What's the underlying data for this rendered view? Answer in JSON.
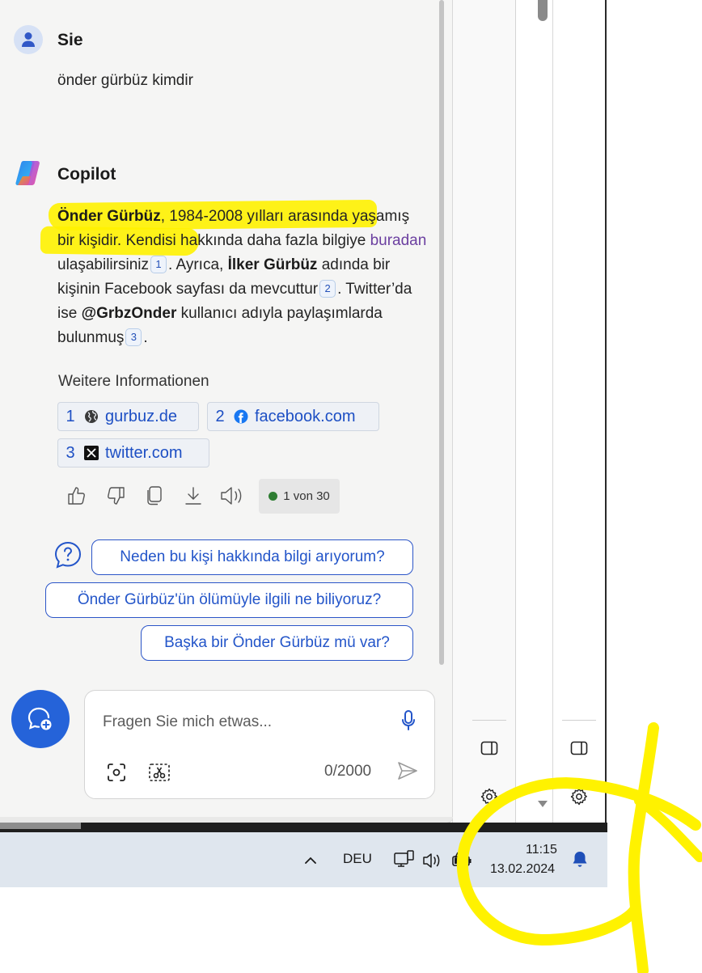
{
  "conversation": {
    "user": {
      "name": "Sie",
      "message": "önder gürbüz kimdir"
    },
    "assistant": {
      "name": "Copilot",
      "answer": {
        "p1_bold": "Önder Gürbüz",
        "p1_a": ", 1984-2008 yılları arasında yaşamış bir kişidir. Kendisi hakkında daha fazla bilgiye ",
        "link": "buradan",
        "p1_b": " ulaşabilirsiniz",
        "cite1": "1",
        "p2_a": ". Ayrıca, ",
        "p2_bold": "İlker Gürbüz",
        "p2_b": " adında bir kişinin Facebook sayfası da mevcuttur",
        "cite2": "2",
        "p3_a": ". Twitter’da ise ",
        "p3_bold": "@GrbzOnder",
        "p3_b": " kullanıcı adıyla paylaşımlarda bulunmuş",
        "cite3": "3",
        "end": "."
      },
      "more_info_title": "Weitere Informationen",
      "sources": [
        {
          "num": "1",
          "label": "gurbuz.de",
          "icon": "globe-icon"
        },
        {
          "num": "2",
          "label": "facebook.com",
          "icon": "facebook-icon"
        },
        {
          "num": "3",
          "label": "twitter.com",
          "icon": "x-icon"
        }
      ],
      "actions": [
        "thumbs-up-icon",
        "thumbs-down-icon",
        "copy-icon",
        "download-icon",
        "speaker-icon"
      ],
      "turn_counter": "1 von 30"
    },
    "suggestions": [
      "Neden bu kişi hakkında bilgi arıyorum?",
      "Önder Gürbüz'ün ölümüyle ilgili ne biliyoruz?",
      "Başka bir Önder Gürbüz mü var?"
    ]
  },
  "composer": {
    "placeholder": "Fragen Sie mich etwas...",
    "counter": "0/2000"
  },
  "taskbar": {
    "language": "DEU",
    "time": "11:15",
    "date": "13.02.2024"
  },
  "colors": {
    "accent": "#2563d9",
    "highlight": "#fff200",
    "status_dot": "#2e7d32"
  }
}
